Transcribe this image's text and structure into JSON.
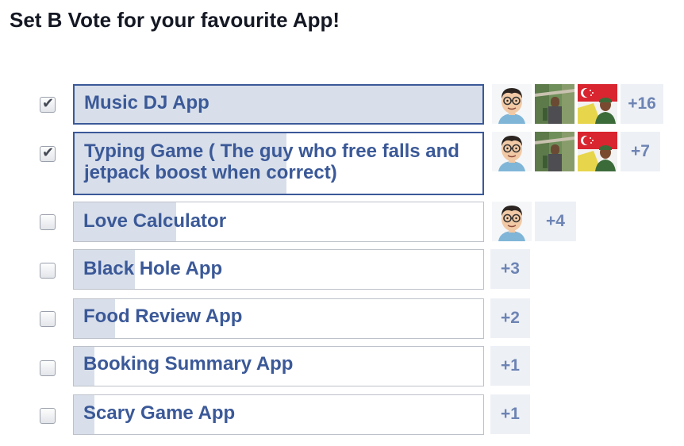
{
  "title": "Set B Vote for your favourite App!",
  "colors": {
    "accent": "#3b5998",
    "fill": "#d8dfea",
    "more_bg": "#edf0f5",
    "more_text": "#6d84b4"
  },
  "options": [
    {
      "label": "Music DJ App",
      "checked": true,
      "vote_share": 1.0,
      "avatars": [
        "avatar-cartoon",
        "avatar-outdoor",
        "avatar-flag"
      ],
      "more": "+16"
    },
    {
      "label": "Typing Game ( The guy who free falls and jetpack boost when correct)",
      "checked": true,
      "vote_share": 0.52,
      "avatars": [
        "avatar-cartoon",
        "avatar-outdoor",
        "avatar-flag"
      ],
      "more": "+7"
    },
    {
      "label": "Love Calculator",
      "checked": false,
      "vote_share": 0.25,
      "avatars": [
        "avatar-cartoon"
      ],
      "more": "+4"
    },
    {
      "label": "Black Hole App",
      "checked": false,
      "vote_share": 0.15,
      "avatars": [],
      "more": "+3"
    },
    {
      "label": "Food Review App",
      "checked": false,
      "vote_share": 0.1,
      "avatars": [],
      "more": "+2"
    },
    {
      "label": "Booking Summary App",
      "checked": false,
      "vote_share": 0.05,
      "avatars": [],
      "more": "+1"
    },
    {
      "label": "Scary Game App",
      "checked": false,
      "vote_share": 0.05,
      "avatars": [],
      "more": "+1"
    }
  ]
}
